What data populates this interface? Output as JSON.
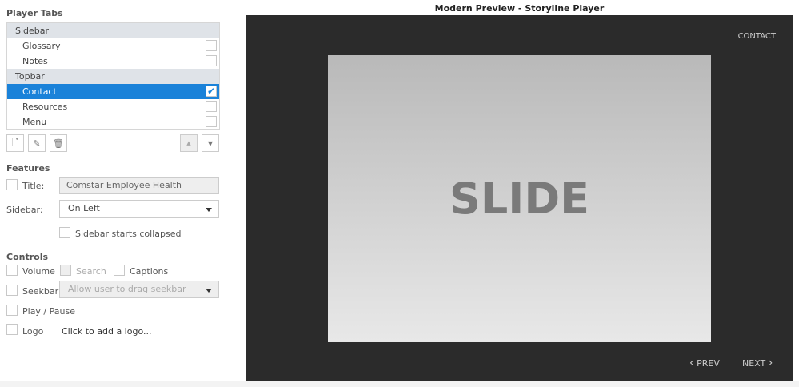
{
  "player_tabs": {
    "heading": "Player Tabs",
    "groups": [
      {
        "label": "Sidebar",
        "items": [
          {
            "label": "Glossary",
            "checked": false
          },
          {
            "label": "Notes",
            "checked": false
          }
        ]
      },
      {
        "label": "Topbar",
        "items": [
          {
            "label": "Contact",
            "checked": true
          },
          {
            "label": "Resources",
            "checked": false
          },
          {
            "label": "Menu",
            "checked": false
          }
        ]
      }
    ]
  },
  "features": {
    "heading": "Features",
    "title_label": "Title:",
    "title_value": "Comstar Employee Health",
    "sidebar_label": "Sidebar:",
    "sidebar_value": "On Left",
    "collapsed_label": "Sidebar starts collapsed"
  },
  "controls": {
    "heading": "Controls",
    "volume": "Volume",
    "search": "Search",
    "captions": "Captions",
    "seekbar": "Seekbar",
    "seekbar_option": "Allow user to drag seekbar",
    "playpause": "Play / Pause",
    "logo": "Logo",
    "logo_link": "Click to add a logo..."
  },
  "preview": {
    "title": "Modern Preview - Storyline Player",
    "contact": "CONTACT",
    "slide": "SLIDE",
    "prev": "PREV",
    "next": "NEXT"
  }
}
